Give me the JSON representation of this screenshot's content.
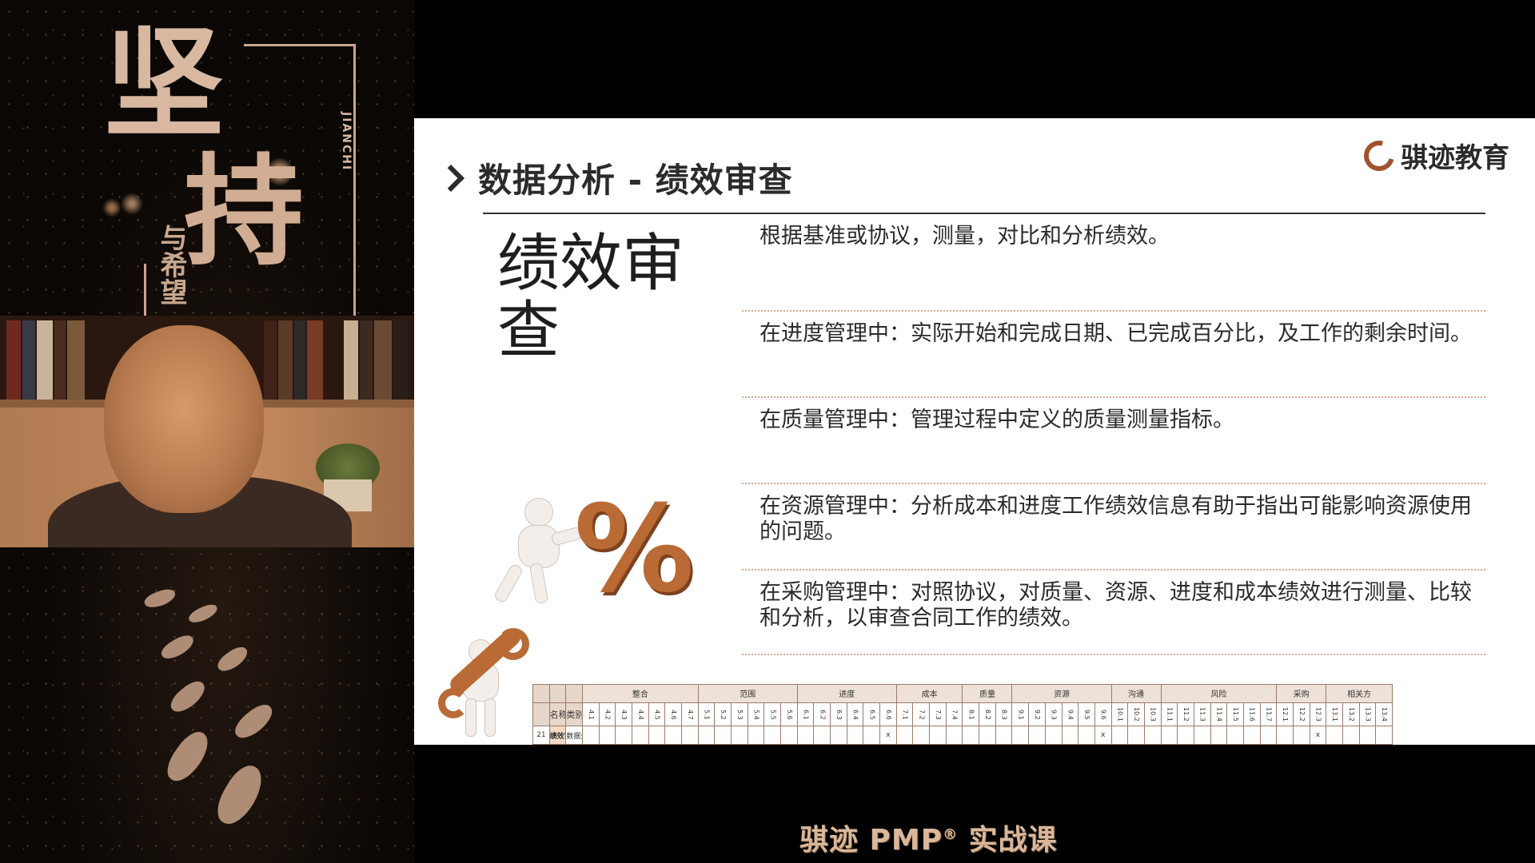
{
  "poster": {
    "char_1": "坚",
    "char_2": "持",
    "subtitle": "与希望",
    "pinyin": "JIANCHI"
  },
  "slide": {
    "title": "数据分析 - 绩效审查",
    "logo_text": "骐迹教育",
    "big_label": "绩效审查",
    "items": [
      "根据基准或协议，测量，对比和分析绩效。",
      "在进度管理中：实际开始和完成日期、已完成百分比，及工作的剩余时间。",
      "在质量管理中：管理过程中定义的质量测量指标。",
      "在资源管理中：分析成本和进度工作绩效信息有助于指出可能影响资源使用的问题。",
      "在采购管理中：对照协议，对质量、资源、进度和成本绩效进行测量、比较和分析，以审查合同工作的绩效。"
    ],
    "percent_symbol": "%"
  },
  "matrix": {
    "col_name": "名称",
    "col_type": "类别",
    "groups": [
      {
        "name": "整合",
        "codes": [
          "4.1",
          "4.2",
          "4.3",
          "4.4",
          "4.5",
          "4.6",
          "4.7"
        ]
      },
      {
        "name": "范围",
        "codes": [
          "5.1",
          "5.2",
          "5.3",
          "5.4",
          "5.5",
          "5.6"
        ]
      },
      {
        "name": "进度",
        "codes": [
          "6.1",
          "6.2",
          "6.3",
          "6.4",
          "6.5",
          "6.6"
        ]
      },
      {
        "name": "成本",
        "codes": [
          "7.1",
          "7.2",
          "7.3",
          "7.4"
        ]
      },
      {
        "name": "质量",
        "codes": [
          "8.1",
          "8.2",
          "8.3"
        ]
      },
      {
        "name": "资源",
        "codes": [
          "9.1",
          "9.2",
          "9.3",
          "9.4",
          "9.5",
          "9.6"
        ]
      },
      {
        "name": "沟通",
        "codes": [
          "10.1",
          "10.2",
          "10.3"
        ]
      },
      {
        "name": "风险",
        "codes": [
          "11.1",
          "11.2",
          "11.3",
          "11.4",
          "11.5",
          "11.6",
          "11.7"
        ]
      },
      {
        "name": "采购",
        "codes": [
          "12.1",
          "12.2",
          "12.3"
        ]
      },
      {
        "name": "相关方",
        "codes": [
          "13.1",
          "13.2",
          "13.3",
          "13.4"
        ]
      }
    ],
    "row": {
      "index": "21",
      "name": "绩效审查",
      "type": "数据分析",
      "marks": {
        "6.6": "x",
        "9.6": "x",
        "12.3": "x"
      }
    }
  },
  "footer": {
    "brand": "骐迹 PMP",
    "registered": "®",
    "course": " 实战课"
  },
  "colors": {
    "accent": "#b96a35",
    "divider": "#d9a896",
    "footer_text": "#d9b79a"
  }
}
